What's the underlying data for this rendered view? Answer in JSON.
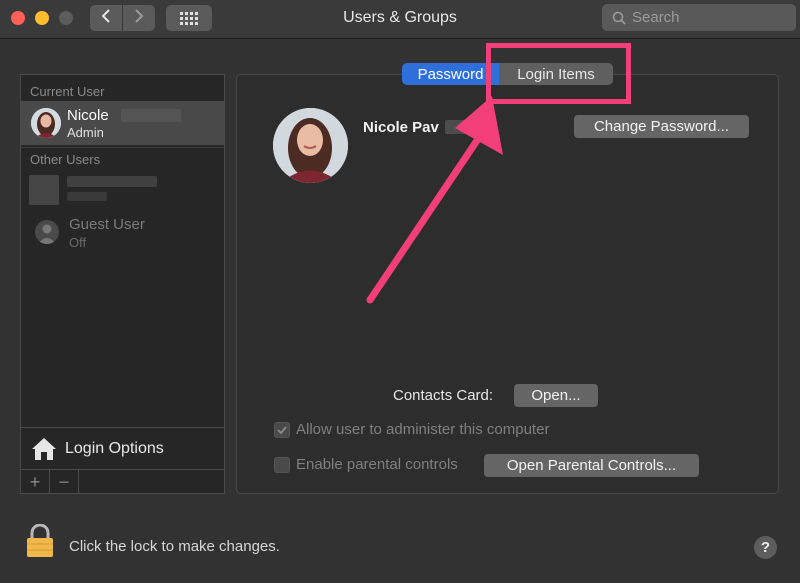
{
  "window": {
    "title": "Users & Groups"
  },
  "search": {
    "placeholder": "Search"
  },
  "sidebar": {
    "current_header": "Current User",
    "current_user": {
      "name": "Nicole",
      "role": "Admin"
    },
    "other_header": "Other Users",
    "guest": {
      "name": "Guest User",
      "status": "Off"
    },
    "login_options": "Login Options",
    "add": "+",
    "remove": "−"
  },
  "tabs": {
    "password": "Password",
    "login_items": "Login Items"
  },
  "user": {
    "full_name": "Nicole Pav"
  },
  "buttons": {
    "change_password": "Change Password...",
    "open": "Open...",
    "open_parental": "Open Parental Controls..."
  },
  "contacts_card_label": "Contacts Card:",
  "checkboxes": {
    "allow_admin": "Allow user to administer this computer",
    "parental": "Enable parental controls"
  },
  "footer": {
    "lock_text": "Click the lock to make changes.",
    "help": "?"
  },
  "colors": {
    "annotation": "#f23f79",
    "selected_tab": "#2f6fdc"
  }
}
